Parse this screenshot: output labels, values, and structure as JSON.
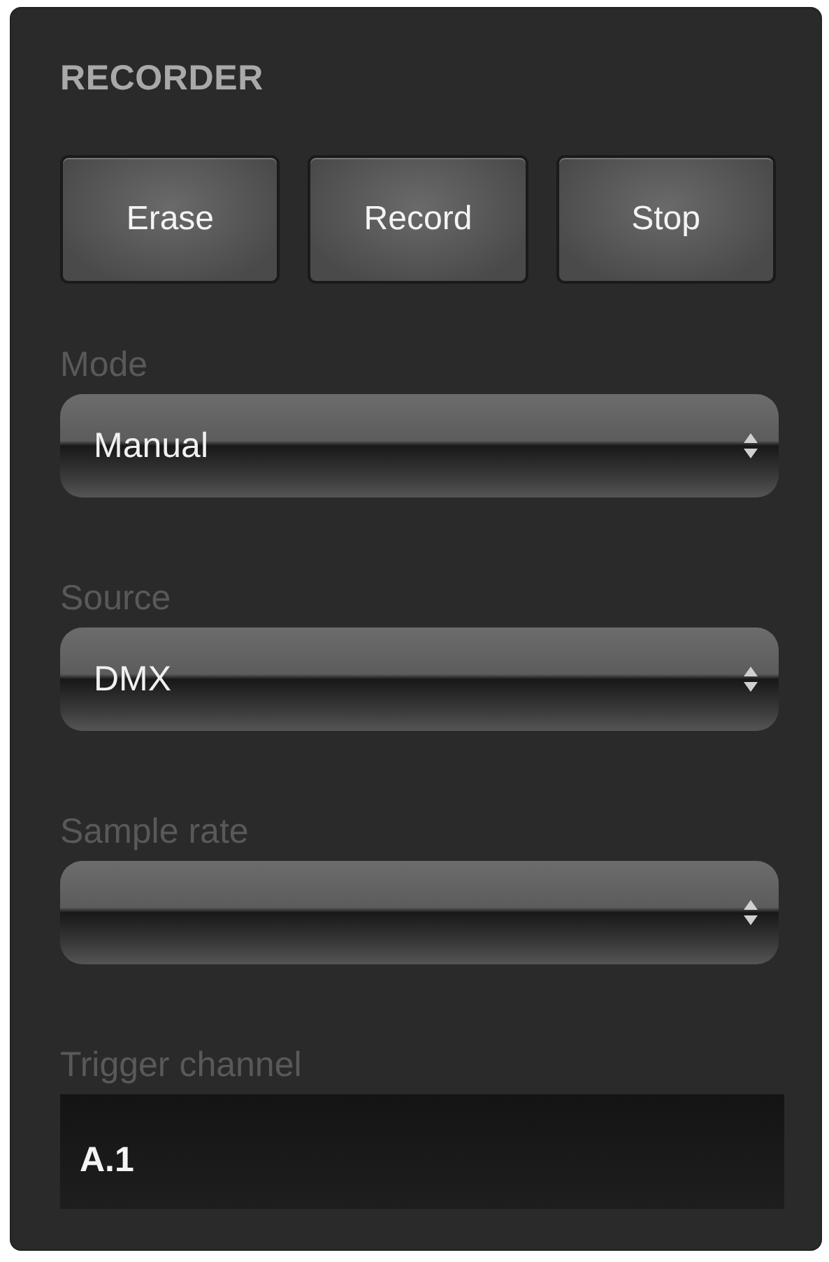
{
  "panel": {
    "title": "RECORDER"
  },
  "buttons": [
    "Erase",
    "Record",
    "Stop"
  ],
  "fields": [
    {
      "kind": "select",
      "label": "Mode",
      "value": "Manual"
    },
    {
      "kind": "select",
      "label": "Source",
      "value": "DMX"
    },
    {
      "kind": "select",
      "label": "Sample rate"
    },
    {
      "kind": "text",
      "label": "Trigger channel",
      "value": "A.1"
    }
  ]
}
